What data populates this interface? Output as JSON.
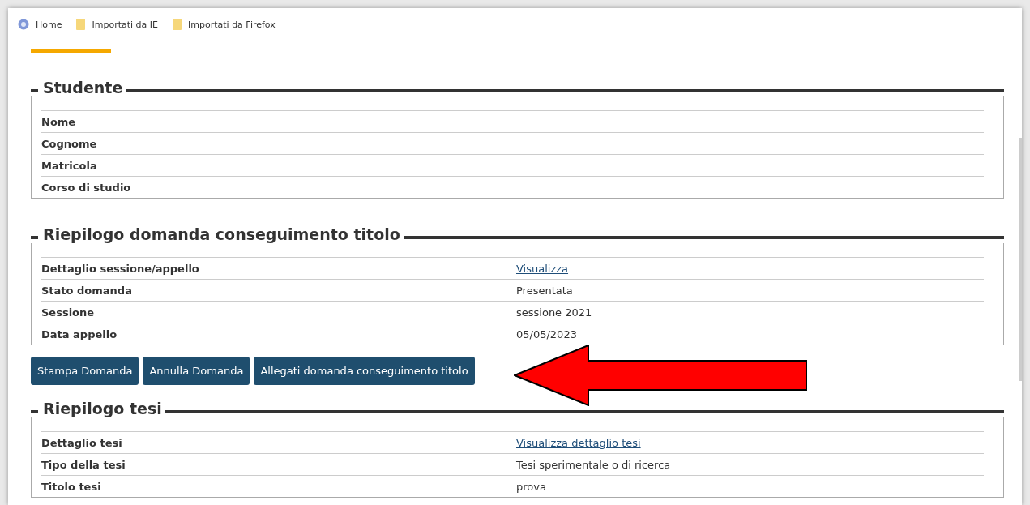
{
  "bookmarks": [
    {
      "label": "Home",
      "kind": "site"
    },
    {
      "label": "Importati da IE",
      "kind": "folder"
    },
    {
      "label": "Importati da Firefox",
      "kind": "folder"
    }
  ],
  "sections": [
    {
      "title": "Studente",
      "rows": [
        {
          "label": "Nome"
        },
        {
          "label": "Cognome"
        },
        {
          "label": "Matricola"
        },
        {
          "label": "Corso di studio"
        }
      ]
    },
    {
      "title": "Riepilogo domanda conseguimento titolo",
      "rows": [
        {
          "label": "Dettaglio sessione/appello",
          "value": "Visualizza ",
          "kind": "link"
        },
        {
          "label": "Stato domanda",
          "value": "Presentata",
          "kind": "text"
        },
        {
          "label": "Sessione",
          "value": "sessione 2021",
          "kind": "text"
        },
        {
          "label": "Data appello",
          "value": "05/05/2023",
          "kind": "text"
        }
      ],
      "buttons": [
        "Stampa Domanda",
        "Annulla Domanda",
        "Allegati domanda conseguimento titolo"
      ]
    },
    {
      "title": "Riepilogo tesi",
      "rows": [
        {
          "label": "Dettaglio tesi",
          "value": "Visualizza dettaglio tesi ",
          "kind": "link"
        },
        {
          "label": "Tipo della tesi",
          "value": "Tesi sperimentale o di ricerca",
          "kind": "text"
        },
        {
          "label": "Titolo tesi",
          "value": "prova",
          "kind": "text"
        }
      ]
    }
  ]
}
